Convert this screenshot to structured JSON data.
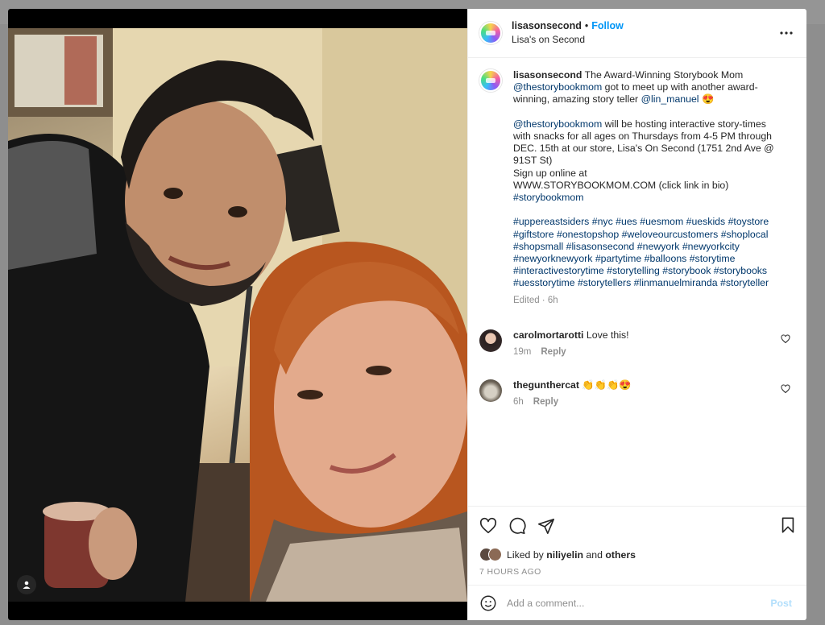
{
  "post": {
    "username": "lisasonsecond",
    "follow_label": "Follow",
    "location": "Lisa's on Second",
    "caption": {
      "username": "lisasonsecond",
      "text_1": " The Award-Winning Storybook Mom ",
      "mention_1": "@thestorybookmom",
      "text_2": " got to meet up with another award-winning, amazing story teller ",
      "mention_2": "@lin_manuel",
      "text_3": " 😍",
      "mention_3": "@thestorybookmom",
      "text_4": " will be hosting interactive story-times with snacks for all ages on Thursdays from 4-5 PM through DEC. 15th at our store, Lisa's On Second (1751 2nd Ave @ 91ST St)\nSign up online at\nWWW.STORYBOOKMOM.COM (click link in bio)",
      "hashtag_line": "#storybookmom",
      "hashtags": "#uppereastsiders #nyc #ues #uesmom #ueskids #toystore #giftstore #onestopshop #weloveourcustomers #shoplocal #shopsmall #lisasonsecond #newyork #newyorkcity #newyorknewyork #partytime #balloons #storytime #interactivestorytime #storytelling #storybook #storybooks #uesstorytime #storytellers #linmanuelmiranda #storyteller",
      "meta": "Edited · 6h"
    },
    "comments": [
      {
        "username": "carolmortarotti",
        "text": "Love this!",
        "time": "19m",
        "reply": "Reply"
      },
      {
        "username": "thegunthercat",
        "text": "👏👏👏😍",
        "time": "6h",
        "reply": "Reply"
      }
    ],
    "likes": {
      "prefix": "Liked by ",
      "user": "niliyelin",
      "middle": " and ",
      "others": "others"
    },
    "timestamp": "7 HOURS AGO",
    "add_comment": {
      "placeholder": "Add a comment...",
      "post_label": "Post"
    }
  },
  "icons": {
    "more": "more-horizontal-icon",
    "like": "heart-icon",
    "comment": "comment-bubble-icon",
    "share": "paper-plane-icon",
    "save": "bookmark-icon",
    "emoji": "smiley-icon",
    "tag_user": "user-tag-icon"
  },
  "colors": {
    "accent": "#0095f6",
    "link": "#00376b",
    "muted": "#8e8e8e",
    "post_disabled": "#b2dffc"
  }
}
